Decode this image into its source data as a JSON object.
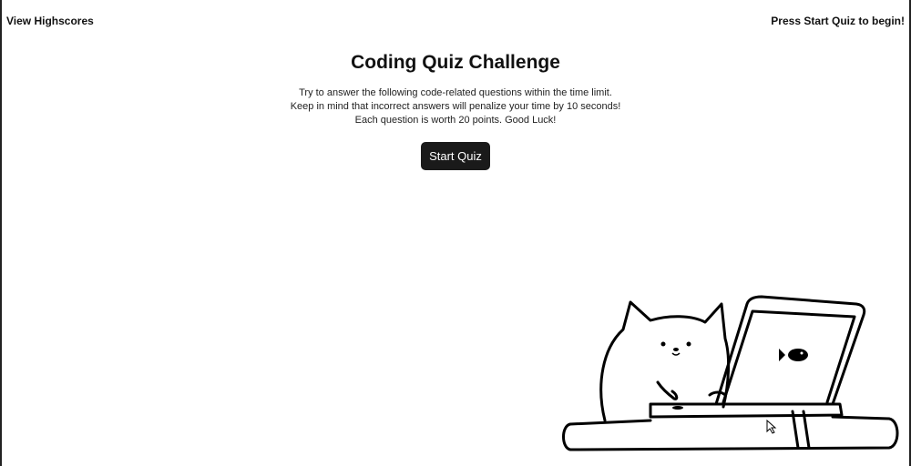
{
  "header": {
    "view_highscores_label": "View Highscores",
    "timer_text": "Press Start Quiz to begin!"
  },
  "main": {
    "title": "Coding Quiz Challenge",
    "intro_lines": [
      "Try to answer the following code-related questions within the time limit.",
      "Keep in mind that incorrect answers will penalize your time by 10 seconds!",
      "Each question is worth 20 points. Good Luck!"
    ],
    "start_button_label": "Start Quiz"
  },
  "illustration": {
    "icon": "cat-with-laptop-icon"
  },
  "colors": {
    "button_bg": "#1a1a1a",
    "button_text": "#ffffff",
    "text": "#111111"
  }
}
